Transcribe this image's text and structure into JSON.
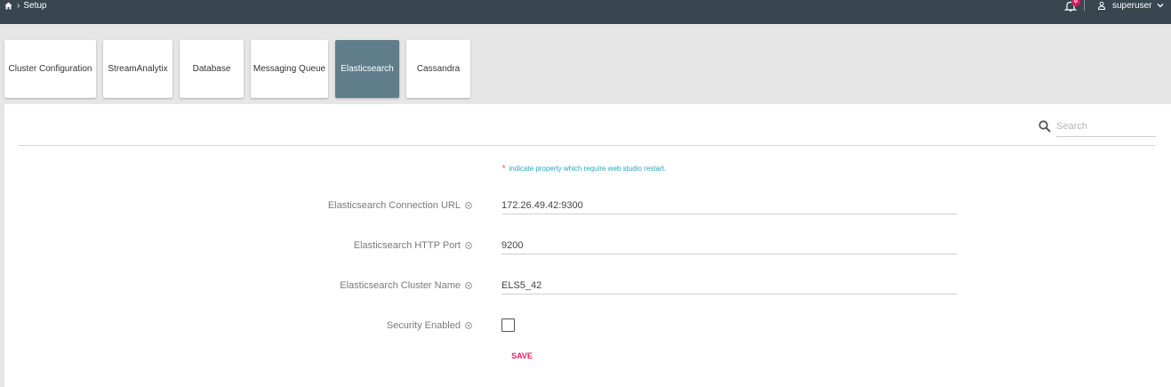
{
  "header": {
    "breadcrumb": "Setup",
    "notification_count": "0",
    "username": "superuser"
  },
  "tabs": [
    {
      "label": "Cluster Configuration",
      "active": false
    },
    {
      "label": "StreamAnalytix",
      "active": false
    },
    {
      "label": "Database",
      "active": false
    },
    {
      "label": "Messaging Queue",
      "active": false
    },
    {
      "label": "Elasticsearch",
      "active": true
    },
    {
      "label": "Cassandra",
      "active": false
    }
  ],
  "search": {
    "placeholder": "Search",
    "value": ""
  },
  "note": {
    "marker": "*",
    "text": "indicate property which require web studio restart."
  },
  "form": {
    "connection_url": {
      "label": "Elasticsearch Connection URL",
      "value": "172.26.49.42:9300"
    },
    "http_port": {
      "label": "Elasticsearch HTTP Port",
      "value": "9200"
    },
    "cluster_name": {
      "label": "Elasticsearch Cluster Name",
      "value": "ELS5_42"
    },
    "security_enabled": {
      "label": "Security Enabled",
      "checked": false
    }
  },
  "save_label": "SAVE",
  "colors": {
    "topbar": "#37464f",
    "active_tab": "#607d8b",
    "accent": "#e91e63",
    "note": "#26a6c9",
    "badge": "#d81b60"
  },
  "icons": [
    "home-icon",
    "chevron-right-icon",
    "bell-icon",
    "user-icon",
    "chevron-down-icon",
    "search-icon",
    "info-icon"
  ]
}
